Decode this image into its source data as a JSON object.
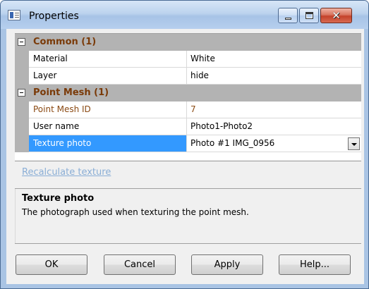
{
  "window": {
    "title": "Properties"
  },
  "grid": {
    "categories": [
      {
        "label": "Common (1)",
        "rows": [
          {
            "name": "Material",
            "value": "White"
          },
          {
            "name": "Layer",
            "value": "hide"
          }
        ]
      },
      {
        "label": "Point Mesh (1)",
        "rows": [
          {
            "name": "Point Mesh ID",
            "value": "7",
            "readonly": true
          },
          {
            "name": "User name",
            "value": "Photo1-Photo2"
          },
          {
            "name": "Texture photo",
            "value": "Photo #1 IMG_0956",
            "selected": true,
            "dropdown": true
          }
        ]
      }
    ]
  },
  "command_link": "Recalculate texture",
  "help": {
    "title": "Texture photo",
    "description": "The photograph used when texturing the point mesh."
  },
  "buttons": {
    "ok": "OK",
    "cancel": "Cancel",
    "apply": "Apply",
    "help": "Help..."
  },
  "colors": {
    "selection": "#3399ff",
    "category_text": "#7a3a08",
    "readonly_text": "#8b4a13",
    "link_disabled": "#8aaed6"
  }
}
